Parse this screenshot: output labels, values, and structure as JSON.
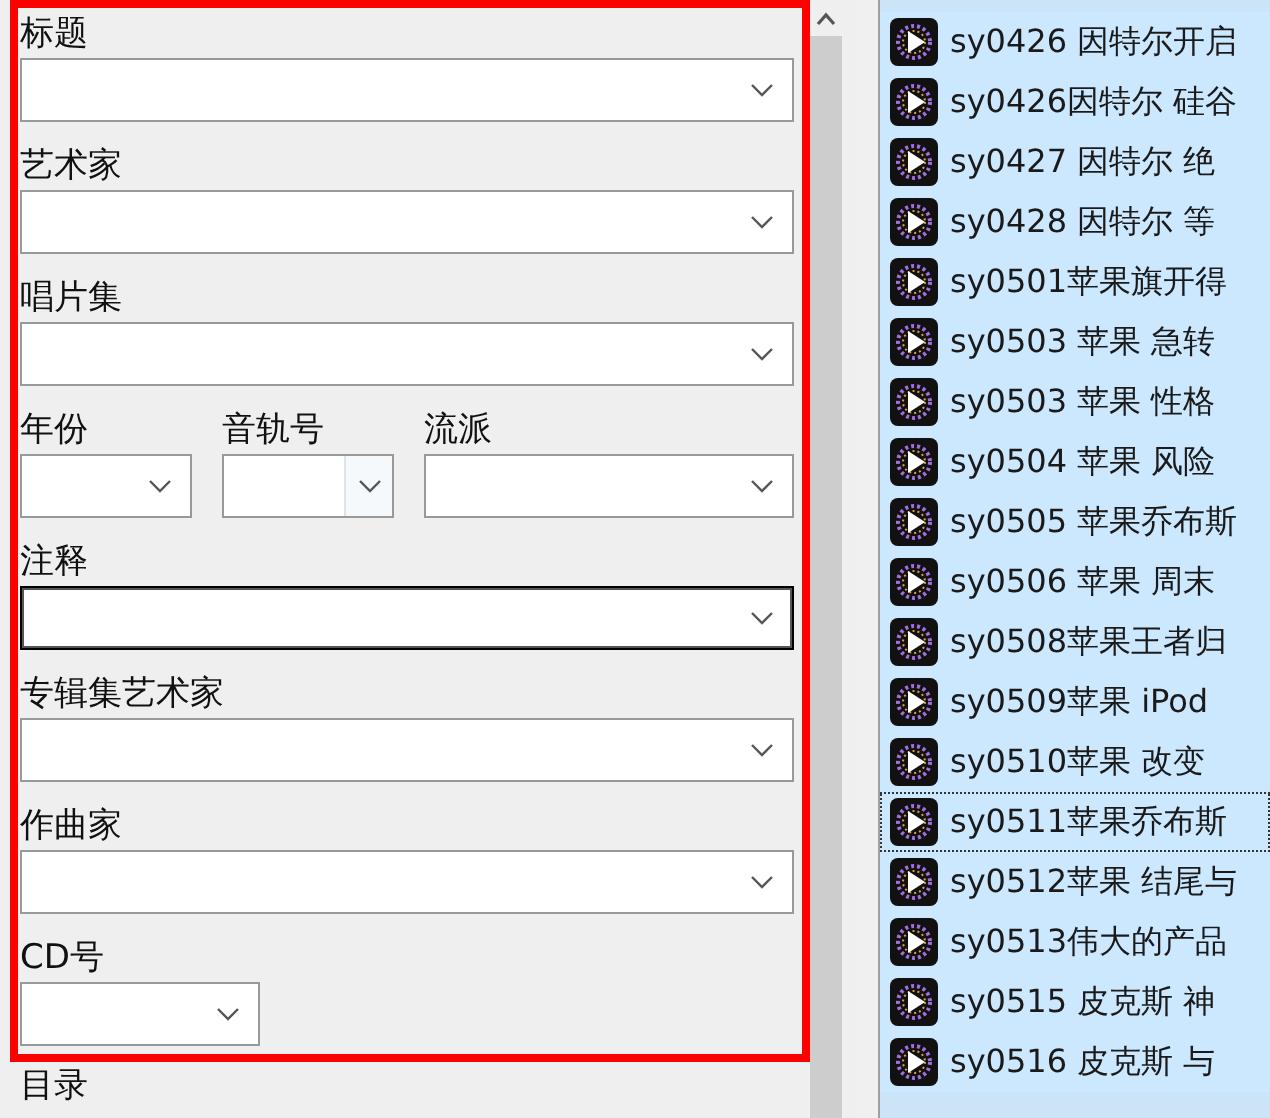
{
  "form": {
    "rows": [
      [
        {
          "label": "标题",
          "kind": "combo",
          "focused": false
        }
      ],
      [
        {
          "label": "艺术家",
          "kind": "combo",
          "focused": false
        }
      ],
      [
        {
          "label": "唱片集",
          "kind": "combo",
          "focused": false
        }
      ],
      [
        {
          "label": "年份",
          "kind": "combo",
          "focused": false
        },
        {
          "label": "音轨号",
          "kind": "editable-combo",
          "focused": false
        },
        {
          "label": "流派",
          "kind": "combo",
          "focused": false
        }
      ],
      [
        {
          "label": "注释",
          "kind": "combo",
          "focused": true
        }
      ],
      [
        {
          "label": "专辑集艺术家",
          "kind": "combo",
          "focused": false
        }
      ],
      [
        {
          "label": "作曲家",
          "kind": "combo",
          "focused": false
        }
      ],
      [
        {
          "label": "CD号",
          "kind": "short-combo",
          "focused": false
        }
      ],
      [
        {
          "label": "目录",
          "kind": "label-only"
        }
      ]
    ]
  },
  "files": [
    {
      "label": "sy0426 因特尔开启",
      "selected": true,
      "focused": false
    },
    {
      "label": "sy0426因特尔 硅谷",
      "selected": true,
      "focused": false
    },
    {
      "label": "sy0427 因特尔 绝",
      "selected": true,
      "focused": false
    },
    {
      "label": "sy0428 因特尔 等",
      "selected": true,
      "focused": false
    },
    {
      "label": "sy0501苹果旗开得",
      "selected": true,
      "focused": false
    },
    {
      "label": "sy0503 苹果 急转",
      "selected": true,
      "focused": false
    },
    {
      "label": "sy0503 苹果 性格",
      "selected": true,
      "focused": false
    },
    {
      "label": "sy0504 苹果 风险",
      "selected": true,
      "focused": false
    },
    {
      "label": "sy0505 苹果乔布斯",
      "selected": true,
      "focused": false
    },
    {
      "label": "sy0506 苹果 周末",
      "selected": true,
      "focused": false
    },
    {
      "label": "sy0508苹果王者归",
      "selected": true,
      "focused": false
    },
    {
      "label": "sy0509苹果 iPod",
      "selected": true,
      "focused": false
    },
    {
      "label": "sy0510苹果 改变",
      "selected": true,
      "focused": false
    },
    {
      "label": "sy0511苹果乔布斯",
      "selected": true,
      "focused": true
    },
    {
      "label": "sy0512苹果 结尾与",
      "selected": true,
      "focused": false
    },
    {
      "label": "sy0513伟大的产品",
      "selected": true,
      "focused": false
    },
    {
      "label": "sy0515 皮克斯 神",
      "selected": true,
      "focused": false
    },
    {
      "label": "sy0516 皮克斯 与",
      "selected": true,
      "focused": false
    }
  ]
}
